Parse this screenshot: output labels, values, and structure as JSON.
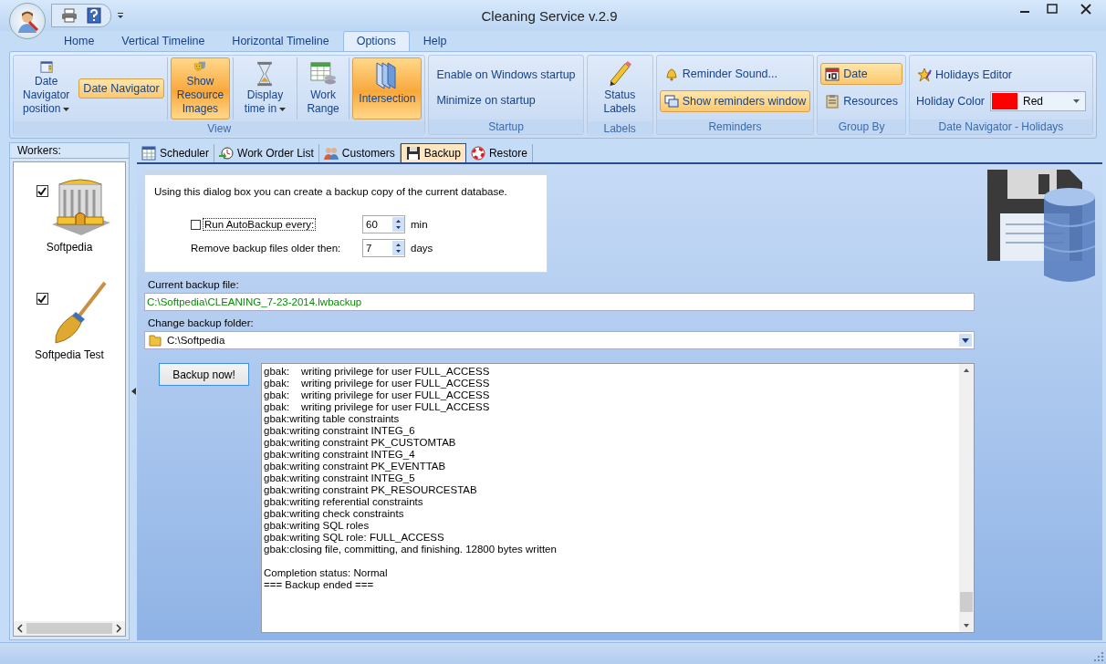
{
  "window": {
    "title": "Cleaning Service v.2.9"
  },
  "ribbon_tabs": [
    {
      "label": "Home",
      "selected": false
    },
    {
      "label": "Vertical Timeline",
      "selected": false
    },
    {
      "label": "Horizontal Timeline",
      "selected": false
    },
    {
      "label": "Options",
      "selected": true
    },
    {
      "label": "Help",
      "selected": false
    }
  ],
  "ribbon_groups": [
    {
      "title": "View",
      "items": [
        {
          "kind": "large",
          "label": "Date Navigator position",
          "active": false,
          "dropdown": true
        },
        {
          "kind": "small",
          "label": "Date Navigator",
          "active": true
        },
        {
          "kind": "large",
          "label": "Show Resource Images",
          "active": true,
          "dropdown": false
        },
        {
          "kind": "large",
          "label": "Display time in",
          "active": false,
          "dropdown": true
        },
        {
          "kind": "large",
          "label": "Work Range",
          "active": false,
          "dropdown": false
        },
        {
          "kind": "large",
          "label": "Intersection",
          "active": true,
          "dropdown": false
        }
      ]
    },
    {
      "title": "Startup",
      "items": [
        {
          "kind": "small",
          "label": "Enable on Windows startup",
          "active": false
        },
        {
          "kind": "small",
          "label": "Minimize on startup",
          "active": false
        }
      ]
    },
    {
      "title": "Labels",
      "items": [
        {
          "kind": "large",
          "label": "Status Labels",
          "active": false,
          "dropdown": false
        }
      ]
    },
    {
      "title": "Reminders",
      "items": [
        {
          "kind": "small",
          "label": "Reminder Sound...",
          "active": false
        },
        {
          "kind": "small",
          "label": "Show reminders window",
          "active": true
        }
      ]
    },
    {
      "title": "Group By",
      "items": [
        {
          "kind": "small",
          "label": "Date",
          "active": true
        },
        {
          "kind": "small",
          "label": "Resources",
          "active": false
        }
      ]
    },
    {
      "title": "Date Navigator - Holidays",
      "items": [
        {
          "kind": "small",
          "label": "Holidays Editor",
          "active": false
        },
        {
          "kind": "color",
          "label": "Holiday Color",
          "value": "Red",
          "color": "#ff0000"
        }
      ]
    }
  ],
  "workers": {
    "title": "Workers:",
    "items": [
      {
        "name": "Softpedia",
        "checked": true
      },
      {
        "name": "Softpedia Test",
        "checked": true
      }
    ]
  },
  "doc_tabs": [
    {
      "label": "Scheduler",
      "selected": false
    },
    {
      "label": "Work Order List",
      "selected": false
    },
    {
      "label": "Customers",
      "selected": false
    },
    {
      "label": "Backup",
      "selected": true
    },
    {
      "label": "Restore",
      "selected": false
    }
  ],
  "backup": {
    "intro": "Using this dialog box you can create a backup copy of the current database.",
    "autobackup": {
      "label": "Run AutoBackup every:",
      "checked": false,
      "value": "60",
      "unit": "min"
    },
    "remove": {
      "label": "Remove backup files older then:",
      "value": "7",
      "unit": "days"
    },
    "current_file": {
      "label": "Current backup file:",
      "value": "C:\\Softpedia\\CLEANING_7-23-2014.lwbackup"
    },
    "folder": {
      "label": "Change backup folder:",
      "value": "C:\\Softpedia"
    },
    "button": "Backup now!",
    "log": [
      "gbak:    writing privilege for user FULL_ACCESS",
      "gbak:    writing privilege for user FULL_ACCESS",
      "gbak:    writing privilege for user FULL_ACCESS",
      "gbak:    writing privilege for user FULL_ACCESS",
      "gbak:writing table constraints",
      "gbak:writing constraint INTEG_6",
      "gbak:writing constraint PK_CUSTOMTAB",
      "gbak:writing constraint INTEG_4",
      "gbak:writing constraint PK_EVENTTAB",
      "gbak:writing constraint INTEG_5",
      "gbak:writing constraint PK_RESOURCESTAB",
      "gbak:writing referential constraints",
      "gbak:writing check constraints",
      "gbak:writing SQL roles",
      "gbak:writing SQL role: FULL_ACCESS",
      "gbak:closing file, committing, and finishing. 12800 bytes written"
    ],
    "summary": [
      "Completion status: Normal",
      "=== Backup ended ==="
    ]
  }
}
